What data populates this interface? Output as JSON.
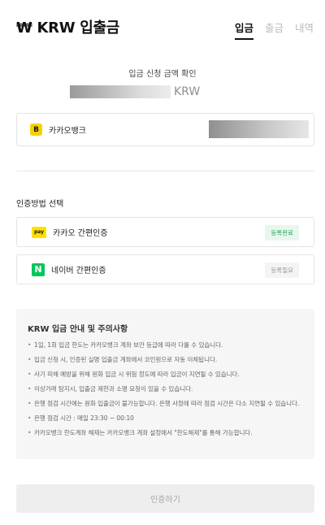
{
  "header": {
    "title": "₩ KRW 입출금",
    "tabs": [
      {
        "label": "입금",
        "active": true
      },
      {
        "label": "출금",
        "active": false
      },
      {
        "label": "내역",
        "active": false
      }
    ]
  },
  "deposit": {
    "confirm_label": "입금 신청 금액 확인",
    "amount_unit": "KRW",
    "bank_logo_letter": "B",
    "bank_name": "카카오뱅크"
  },
  "auth": {
    "section_label": "인증방법 선택",
    "methods": [
      {
        "logo_text": "pay",
        "name": "카카오 간편인증",
        "status": "등록완료",
        "logo_color": "#ffe000",
        "status_color": "#2aa55a"
      },
      {
        "logo_text": "N",
        "name": "네이버 간편인증",
        "status": "등록필요",
        "logo_color": "#03c75a",
        "status_color": "#9a9a9a"
      }
    ]
  },
  "notice": {
    "title": "KRW 입금 안내 및 주의사항",
    "items": [
      "1일, 1회 입금 한도는 카카오뱅크 계좌 보안 등급에 따라 다를 수 있습니다.",
      "입금 신청 시, 인증된 실명 입출금 계좌에서 코인원으로 자동 이체됩니다.",
      "사기 피해 예방을 위해 원화 입금 시 위험 정도에 따라 입금이 지연될 수 있습니다.",
      "이상거래 탐지시, 입출금 제한과 소명 요청이 있을 수 있습니다.",
      "은행 점검 시간에는 원화 입출금이 불가능합니다. 은행 사정에 따라 점검 시간은 다소 지연될 수 있습니다.",
      "은행 점검 시간 : 매일 23:30 ~ 00:10",
      "카카오뱅크 한도계좌 해제는 카카오뱅크 계좌 설정에서 \"한도해제\"를 통해 가능합니다."
    ]
  },
  "submit_label": "인증하기"
}
